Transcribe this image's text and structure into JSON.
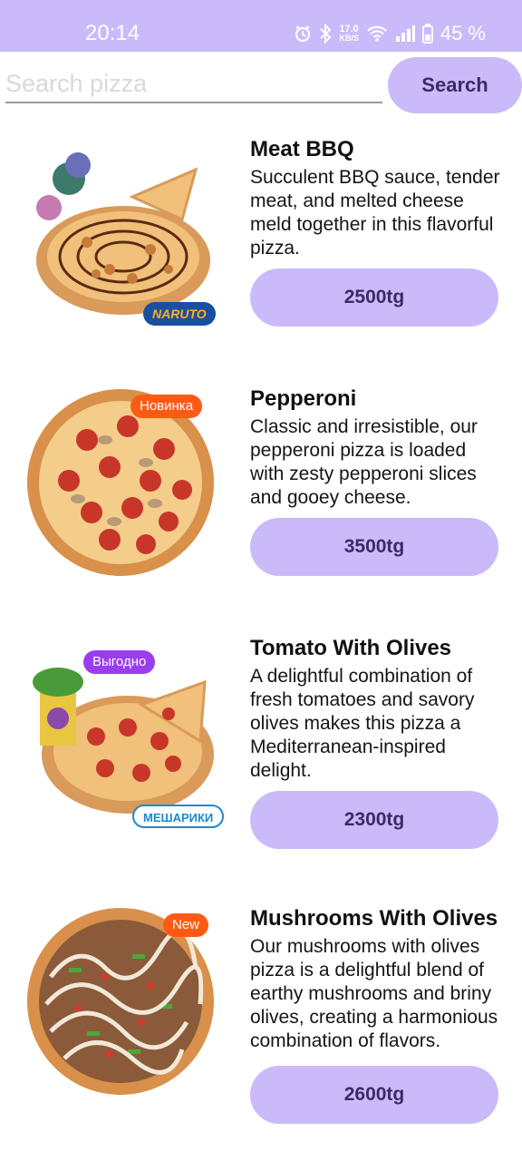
{
  "status_bar": {
    "time": "20:14",
    "net_speed_value": "17.0",
    "net_speed_unit": "KB/S",
    "battery": "45 %",
    "icons": [
      "alarm-icon",
      "bluetooth-icon",
      "wifi-icon",
      "signal-icon",
      "battery-icon"
    ]
  },
  "search": {
    "placeholder": "Search pizza",
    "value": "",
    "button_label": "Search"
  },
  "colors": {
    "accent": "#cbbafa",
    "accent_text": "#3a2a6a",
    "badge_orange": "#ff5a14",
    "badge_purple": "#9a3df0"
  },
  "pizzas": [
    {
      "name": "Meat BBQ",
      "description": "Succulent BBQ sauce, tender meat, and melted cheese meld together in this flavorful pizza.",
      "price": "2500tg",
      "badge": "",
      "brand_logo": "NARUTO"
    },
    {
      "name": "Pepperoni",
      "description": "Classic and irresistible, our pepperoni pizza is loaded with zesty pepperoni slices and gooey cheese.",
      "price": "3500tg",
      "badge": "Новинка"
    },
    {
      "name": "Tomato With Olives",
      "description": "A delightful combination of fresh tomatoes and savory olives makes this pizza a Mediterranean-inspired delight.",
      "price": "2300tg",
      "badge": "Выгодно",
      "brand_logo": "МЕШАРИКИ"
    },
    {
      "name": "Mushrooms With Olives",
      "description": "Our mushrooms with olives pizza is a delightful blend of earthy mushrooms and briny olives, creating a harmonious combination of flavors.",
      "price": "2600tg",
      "badge": "New"
    }
  ]
}
